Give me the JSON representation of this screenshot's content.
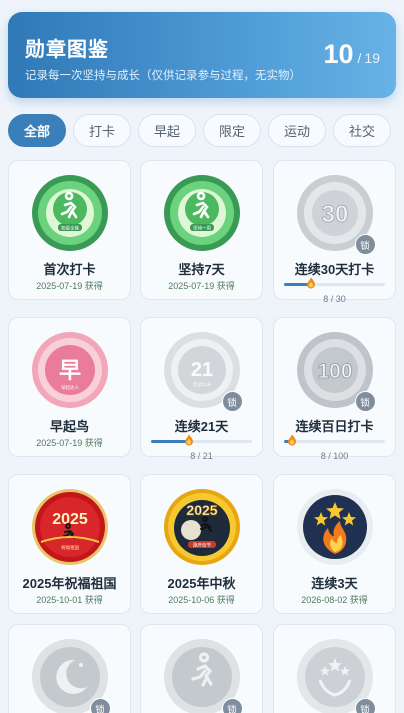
{
  "header": {
    "title": "勋章图鉴",
    "subtitle": "记录每一次坚持与成长（仅供记录参与过程，无实物）",
    "unlocked": "10",
    "separator": "/",
    "total": "19"
  },
  "tabs": [
    {
      "label": "全部",
      "active": true
    },
    {
      "label": "打卡",
      "active": false
    },
    {
      "label": "早起",
      "active": false
    },
    {
      "label": "限定",
      "active": false
    },
    {
      "label": "运动",
      "active": false
    },
    {
      "label": "社交",
      "active": false
    }
  ],
  "badges": [
    {
      "name": "首次打卡",
      "date": "2025-07-19 获得",
      "locked": false,
      "medal_text": "",
      "ribbon": "初级全能",
      "icon": "runner-icon",
      "style": "green"
    },
    {
      "name": "坚持7天",
      "date": "2025-07-19 获得",
      "locked": false,
      "medal_text": "",
      "ribbon": "坚持一周",
      "icon": "runner-icon",
      "style": "green"
    },
    {
      "name": "连续30天打卡",
      "locked": true,
      "lock_label": "锁",
      "medal_text": "30",
      "progress_text": "8 / 30",
      "progress": 0.267,
      "style": "gray"
    },
    {
      "name": "早起鸟",
      "date": "2025-07-19 获得",
      "locked": false,
      "medal_text": "早",
      "ribbon": "早起达人",
      "style": "pink"
    },
    {
      "name": "连续21天",
      "locked": true,
      "lock_label": "锁",
      "medal_text": "21",
      "ribbon": "连续21天",
      "progress_text": "8 / 21",
      "progress": 0.381,
      "style": "light-gray"
    },
    {
      "name": "连续百日打卡",
      "locked": true,
      "lock_label": "锁",
      "medal_text": "100",
      "progress_text": "8 / 100",
      "progress": 0.08,
      "style": "gray"
    },
    {
      "name": "2025年祝福祖国",
      "date": "2025-10-01 获得",
      "locked": false,
      "medal_text": "2025",
      "ribbon": "祝福祖国",
      "icon": "runner-icon",
      "style": "red"
    },
    {
      "name": "2025年中秋",
      "date": "2025-10-06 获得",
      "locked": false,
      "medal_text": "2025",
      "ribbon": "跑庆佳节",
      "icon": "runner-moon-icon",
      "style": "gold"
    },
    {
      "name": "连续3天",
      "date": "2026-08-02 获得",
      "locked": false,
      "medal_text": "",
      "icon": "stars-flame-icon",
      "style": "navy"
    },
    {
      "name": "",
      "locked": true,
      "lock_label": "锁",
      "icon": "moon-icon",
      "style": "gray"
    },
    {
      "name": "",
      "locked": true,
      "lock_label": "锁",
      "icon": "runner-icon",
      "style": "gray"
    },
    {
      "name": "",
      "locked": true,
      "lock_label": "锁",
      "icon": "laurel-stars-icon",
      "style": "gray"
    }
  ],
  "colors": {
    "accent": "#3a7fb9",
    "green_medal": "#4cb860",
    "pink_medal": "#ea7c9a",
    "red_medal": "#c2161b",
    "gold_medal": "#f2b418",
    "navy_medal": "#1f3050",
    "locked_gray": "#b8bec5"
  }
}
